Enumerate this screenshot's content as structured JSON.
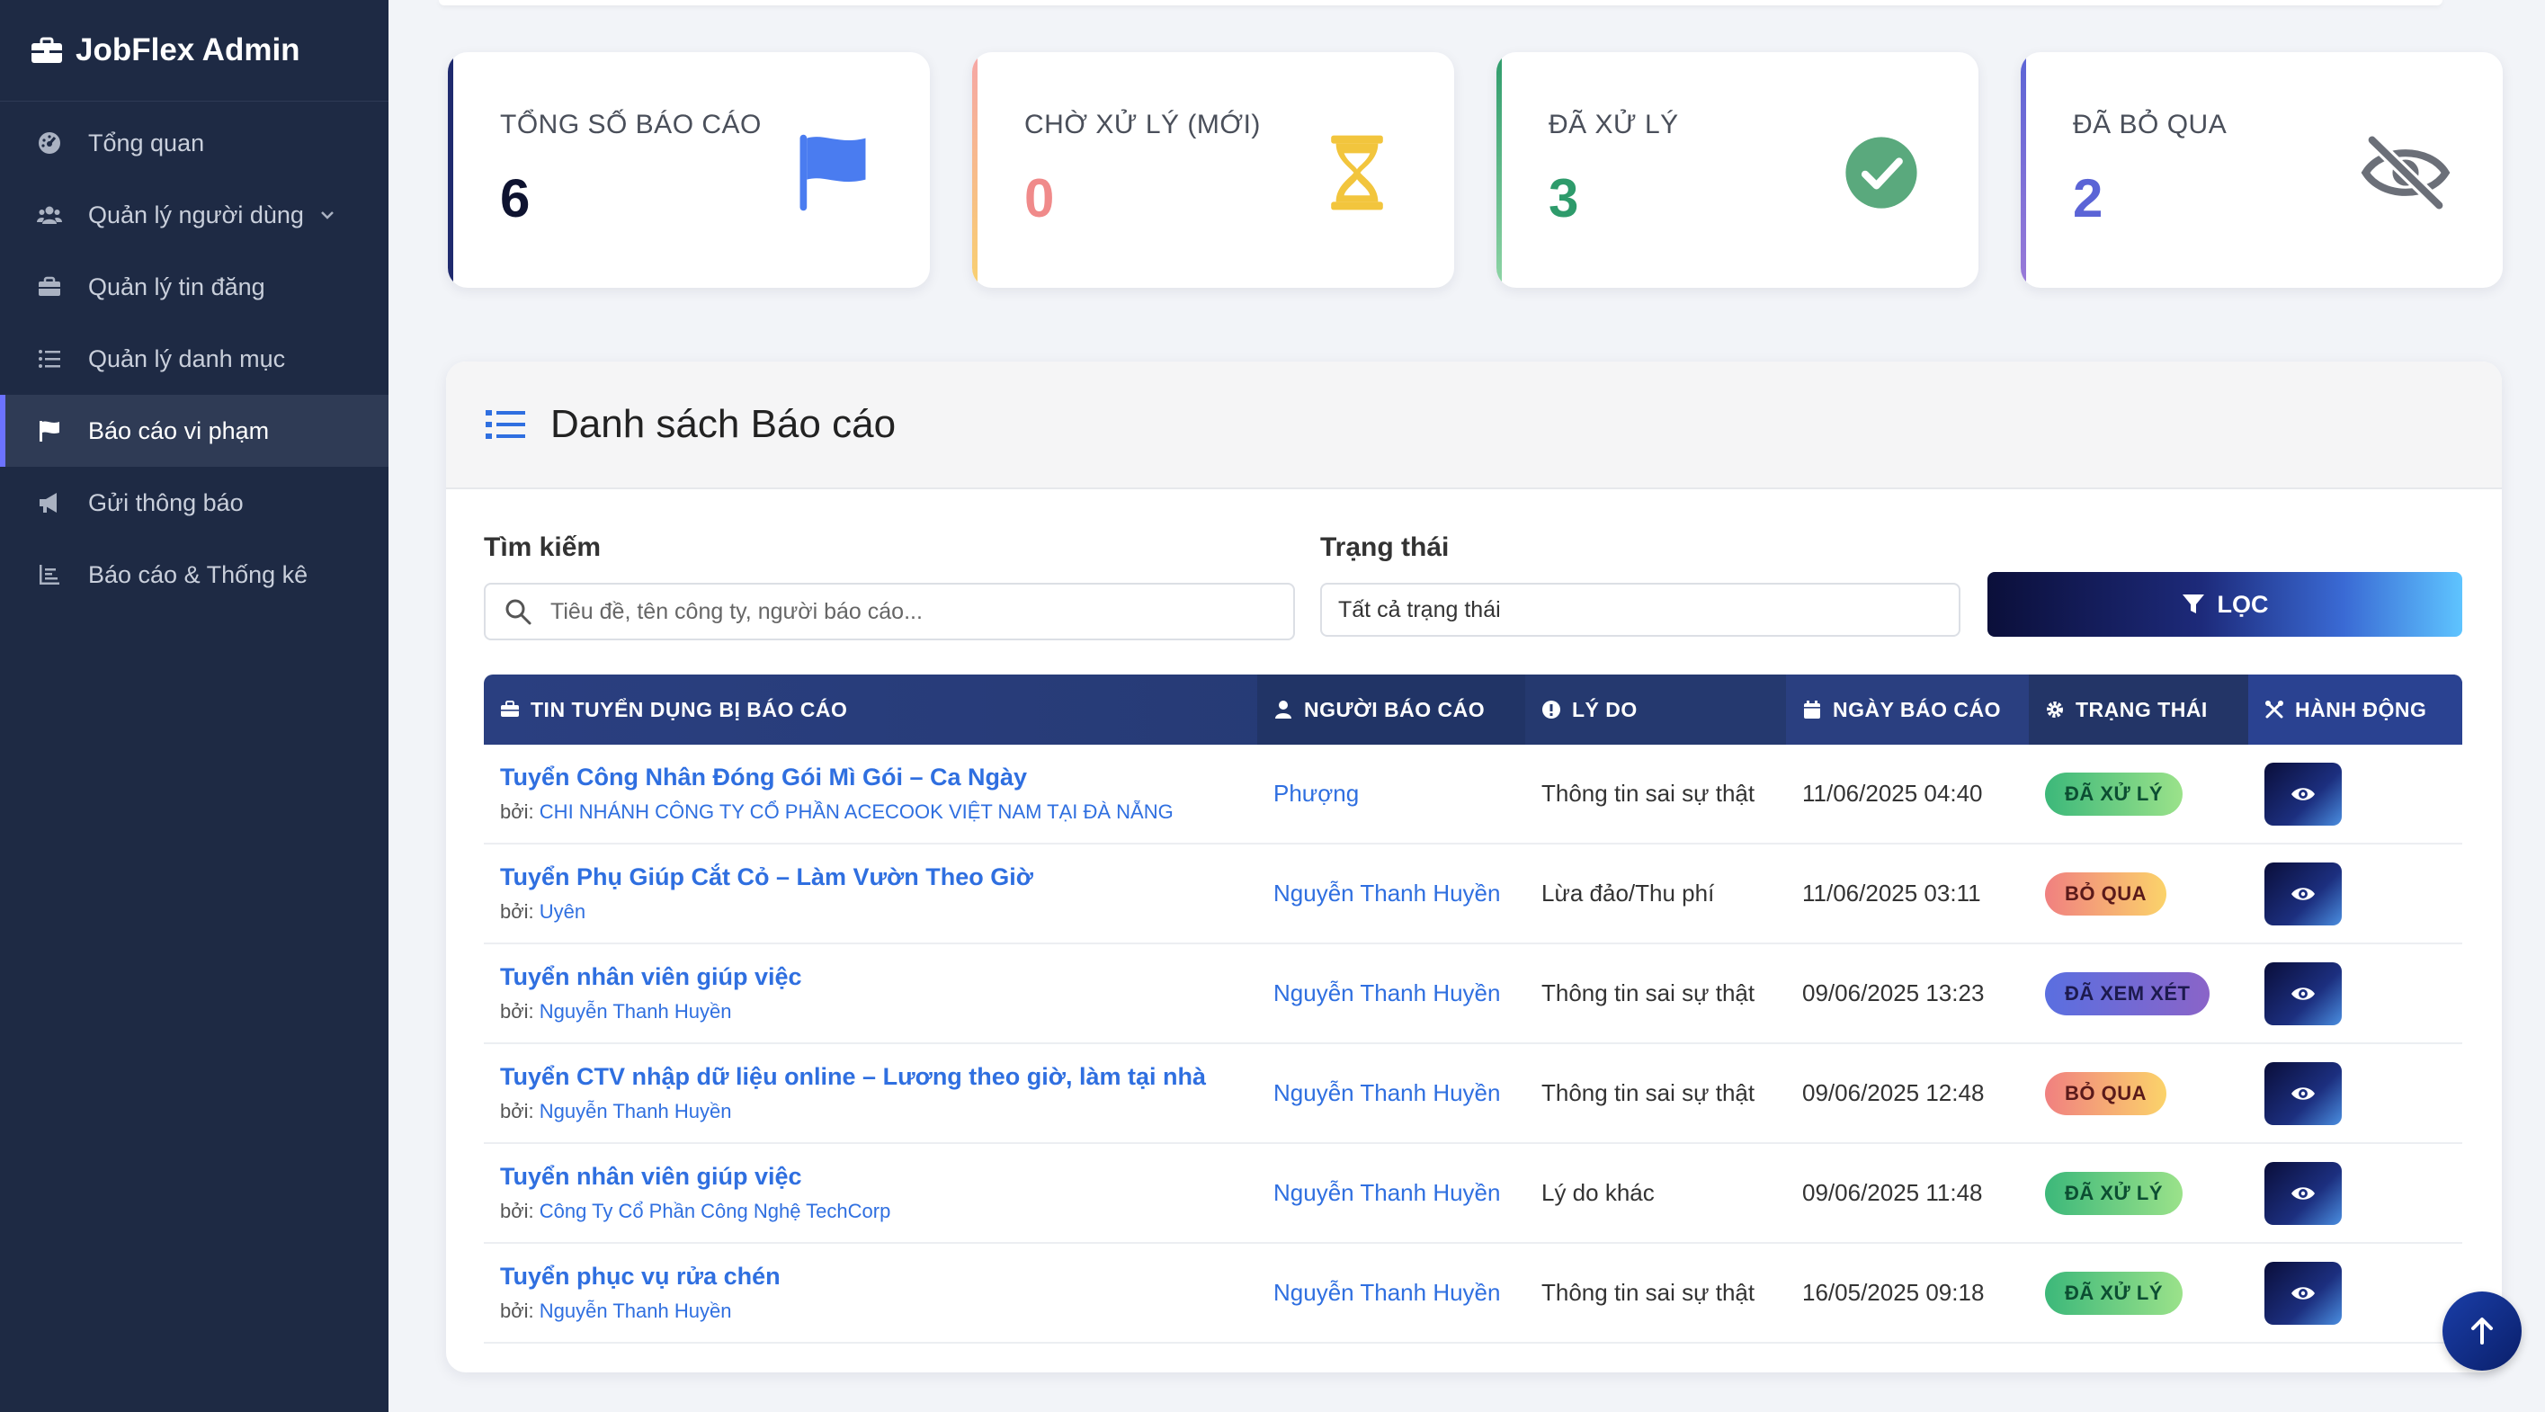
{
  "app": {
    "brand": "JobFlex Admin"
  },
  "sidebar": {
    "items": [
      {
        "label": "Tổng quan",
        "icon": "dashboard-icon"
      },
      {
        "label": "Quản lý người dùng",
        "icon": "users-icon"
      },
      {
        "label": "Quản lý tin đăng",
        "icon": "briefcase-icon"
      },
      {
        "label": "Quản lý danh mục",
        "icon": "list-icon"
      },
      {
        "label": "Báo cáo vi phạm",
        "icon": "flag-icon",
        "active": true
      },
      {
        "label": "Gửi thông báo",
        "icon": "megaphone-icon"
      },
      {
        "label": "Báo cáo & Thống kê",
        "icon": "chart-icon"
      }
    ]
  },
  "stats": [
    {
      "label": "TỔNG SỐ BÁO CÁO",
      "value": "6",
      "color": "#1f2a6e",
      "icon": "flag-icon"
    },
    {
      "label": "CHỜ XỬ LÝ (MỚI)",
      "value": "0",
      "color": "#f08a8a",
      "icon": "hourglass-icon"
    },
    {
      "label": "ĐÃ XỬ LÝ",
      "value": "3",
      "color": "#2e9b6b",
      "icon": "check-circle-icon"
    },
    {
      "label": "ĐÃ BỎ QUA",
      "value": "2",
      "color": "#5b64d6",
      "icon": "eye-slash-icon"
    }
  ],
  "panel": {
    "title": "Danh sách Báo cáo",
    "search_label": "Tìm kiếm",
    "search_placeholder": "Tiêu đề, tên công ty, người báo cáo...",
    "status_label": "Trạng thái",
    "status_value": "Tất cả trạng thái",
    "filter_button": "LỌC"
  },
  "table": {
    "headers": [
      "TIN TUYỂN DỤNG BỊ BÁO CÁO",
      "NGƯỜI BÁO CÁO",
      "LÝ DO",
      "NGÀY BÁO CÁO",
      "TRẠNG THÁI",
      "HÀNH ĐỘNG"
    ],
    "by_prefix": "bởi:",
    "rows": [
      {
        "title": "Tuyển Công Nhân Đóng Gói Mì Gói – Ca Ngày",
        "by": "CHI NHÁNH CÔNG TY CỔ PHẦN ACECOOK VIỆT NAM TẠI ĐÀ NẴNG",
        "reporter": "Phượng",
        "reason": "Thông tin sai sự thật",
        "date": "11/06/2025 04:40",
        "status": "ĐÃ XỬ LÝ",
        "status_kind": "done"
      },
      {
        "title": "Tuyển Phụ Giúp Cắt Cỏ – Làm Vườn Theo Giờ",
        "by": "Uyên",
        "reporter": "Nguyễn Thanh Huyền",
        "reason": "Lừa đảo/Thu phí",
        "date": "11/06/2025 03:11",
        "status": "BỎ QUA",
        "status_kind": "skip"
      },
      {
        "title": "Tuyển nhân viên giúp việc",
        "by": "Nguyễn Thanh Huyền",
        "reporter": "Nguyễn Thanh Huyền",
        "reason": "Thông tin sai sự thật",
        "date": "09/06/2025 13:23",
        "status": "ĐÃ XEM XÉT",
        "status_kind": "review"
      },
      {
        "title": "Tuyển CTV nhập dữ liệu online – Lương theo giờ, làm tại nhà",
        "by": "Nguyễn Thanh Huyền",
        "reporter": "Nguyễn Thanh Huyền",
        "reason": "Thông tin sai sự thật",
        "date": "09/06/2025 12:48",
        "status": "BỎ QUA",
        "status_kind": "skip"
      },
      {
        "title": "Tuyển nhân viên giúp việc",
        "by": "Công Ty Cổ Phần Công Nghệ TechCorp",
        "reporter": "Nguyễn Thanh Huyền",
        "reason": "Lý do khác",
        "date": "09/06/2025 11:48",
        "status": "ĐÃ XỬ LÝ",
        "status_kind": "done"
      },
      {
        "title": "Tuyển phục vụ rửa chén",
        "by": "Nguyễn Thanh Huyền",
        "reporter": "Nguyễn Thanh Huyền",
        "reason": "Thông tin sai sự thật",
        "date": "16/05/2025 09:18",
        "status": "ĐÃ XỬ LÝ",
        "status_kind": "done"
      }
    ]
  }
}
